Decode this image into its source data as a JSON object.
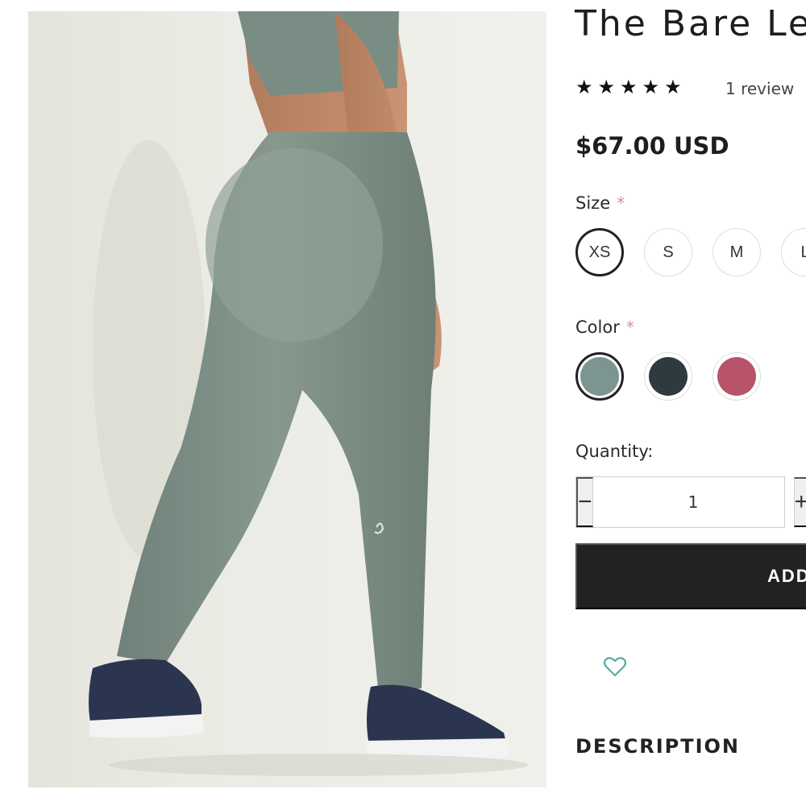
{
  "product": {
    "title": "The Bare Le",
    "rating_stars": 5,
    "star_glyph": "★",
    "review_count": "1 review",
    "price": "$67.00 USD"
  },
  "options": {
    "size_label": "Size",
    "required_mark": "*",
    "sizes": [
      "XS",
      "S",
      "M",
      "L"
    ],
    "selected_size": "XS",
    "color_label": "Color",
    "colors": [
      {
        "name": "sage-green",
        "hex": "#7d9590"
      },
      {
        "name": "charcoal",
        "hex": "#2e3a3d"
      },
      {
        "name": "rose",
        "hex": "#b8546a"
      }
    ],
    "selected_color": "sage-green"
  },
  "quantity": {
    "label": "Quantity:",
    "value": "1",
    "minus_glyph": "−",
    "plus_glyph": "+"
  },
  "cart": {
    "add_label": "ADD"
  },
  "wishlist": {
    "icon": "heart-outline-icon",
    "color": "#5aa9a6"
  },
  "description": {
    "heading": "DESCRIPTION"
  },
  "colors": {
    "button_bg": "#222222",
    "text": "#222222",
    "required": "#e08a9c"
  }
}
